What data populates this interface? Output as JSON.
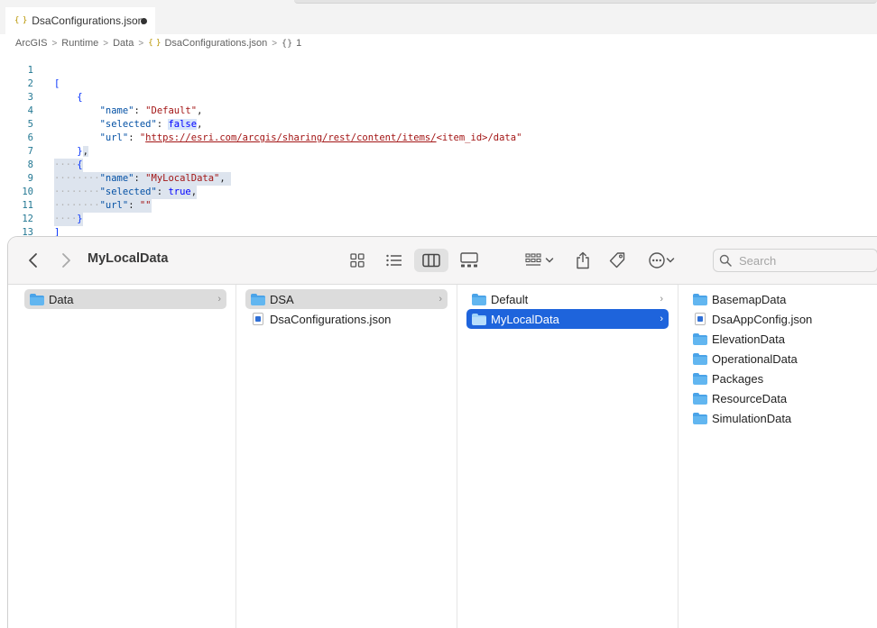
{
  "editor": {
    "tab": {
      "label": "DsaConfigurations.json"
    },
    "breadcrumb": [
      "ArcGIS",
      "Runtime",
      "Data",
      "DsaConfigurations.json",
      "1"
    ],
    "lines": [
      {
        "n": "1"
      },
      {
        "n": "2"
      },
      {
        "n": "3",
        "key": "\"name\"",
        "val": "\"Default\""
      },
      {
        "n": "4",
        "key": "\"selected\"",
        "val": "false"
      },
      {
        "n": "5",
        "key": "\"url\"",
        "q": "\"",
        "link": "https://esri.com/arcgis/sharing/rest/content/items/",
        "rest": "<item_id>/data\""
      },
      {
        "n": "6"
      },
      {
        "n": "7"
      },
      {
        "n": "8",
        "key": "\"name\"",
        "val": "\"MyLocalData\""
      },
      {
        "n": "9",
        "key": "\"selected\"",
        "val": "true"
      },
      {
        "n": "10",
        "key": "\"url\"",
        "val": "\"\""
      },
      {
        "n": "11"
      },
      {
        "n": "12"
      },
      {
        "n": "13"
      }
    ]
  },
  "finder": {
    "title": "MyLocalData",
    "search_placeholder": "Search",
    "columns": [
      {
        "items": [
          {
            "name": "Data",
            "kind": "folder",
            "state": "selected-inactive",
            "has_children": true
          }
        ]
      },
      {
        "items": [
          {
            "name": "DSA",
            "kind": "folder",
            "state": "selected-inactive",
            "has_children": true
          },
          {
            "name": "DsaConfigurations.json",
            "kind": "file"
          }
        ]
      },
      {
        "items": [
          {
            "name": "Default",
            "kind": "folder",
            "has_children": true
          },
          {
            "name": "MyLocalData",
            "kind": "folder",
            "state": "selected-active",
            "has_children": true
          }
        ]
      },
      {
        "items": [
          {
            "name": "BasemapData",
            "kind": "folder"
          },
          {
            "name": "DsaAppConfig.json",
            "kind": "file"
          },
          {
            "name": "ElevationData",
            "kind": "folder"
          },
          {
            "name": "OperationalData",
            "kind": "folder"
          },
          {
            "name": "Packages",
            "kind": "folder"
          },
          {
            "name": "ResourceData",
            "kind": "folder"
          },
          {
            "name": "SimulationData",
            "kind": "folder"
          }
        ]
      }
    ],
    "colors": {
      "selection_active": "#1e64dc",
      "selection_inactive": "#dcdcdc",
      "folder": "#62b6f0"
    }
  }
}
